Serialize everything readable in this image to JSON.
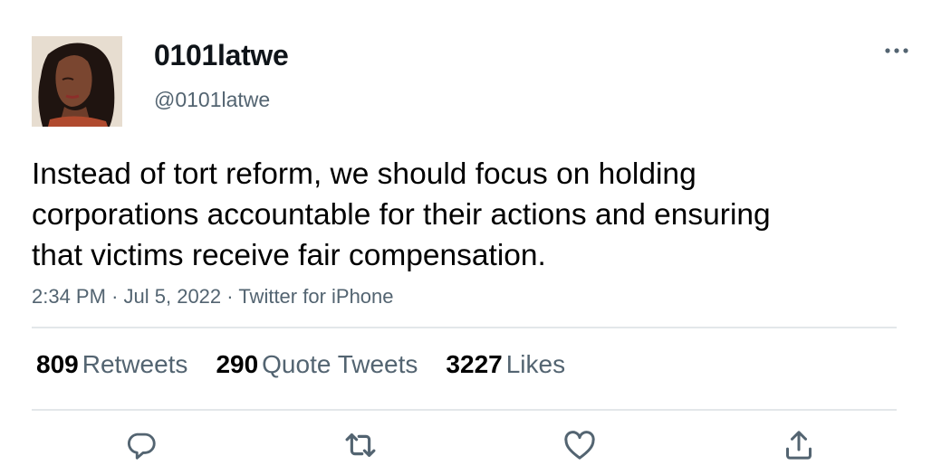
{
  "user": {
    "display_name": "0101latwe",
    "handle": "@0101latwe"
  },
  "tweet": {
    "text": "Instead of tort reform, we should focus on holding corporations accountable for their actions and ensuring that victims receive fair compensation.",
    "time": "2:34 PM",
    "date": "Jul 5, 2022",
    "source": "Twitter for iPhone",
    "separator": "·"
  },
  "stats": {
    "retweets": {
      "count": "809",
      "label": "Retweets"
    },
    "quote_tweets": {
      "count": "290",
      "label": "Quote Tweets"
    },
    "likes": {
      "count": "3227",
      "label": "Likes"
    }
  },
  "actions": [
    "reply-icon",
    "retweet-icon",
    "like-icon",
    "share-icon"
  ],
  "icons": {
    "more": "more-horizontal-icon"
  },
  "colors": {
    "text": "#0f1419",
    "secondary": "#536471",
    "divider": "#e3e7ea",
    "icon": "#536471"
  }
}
